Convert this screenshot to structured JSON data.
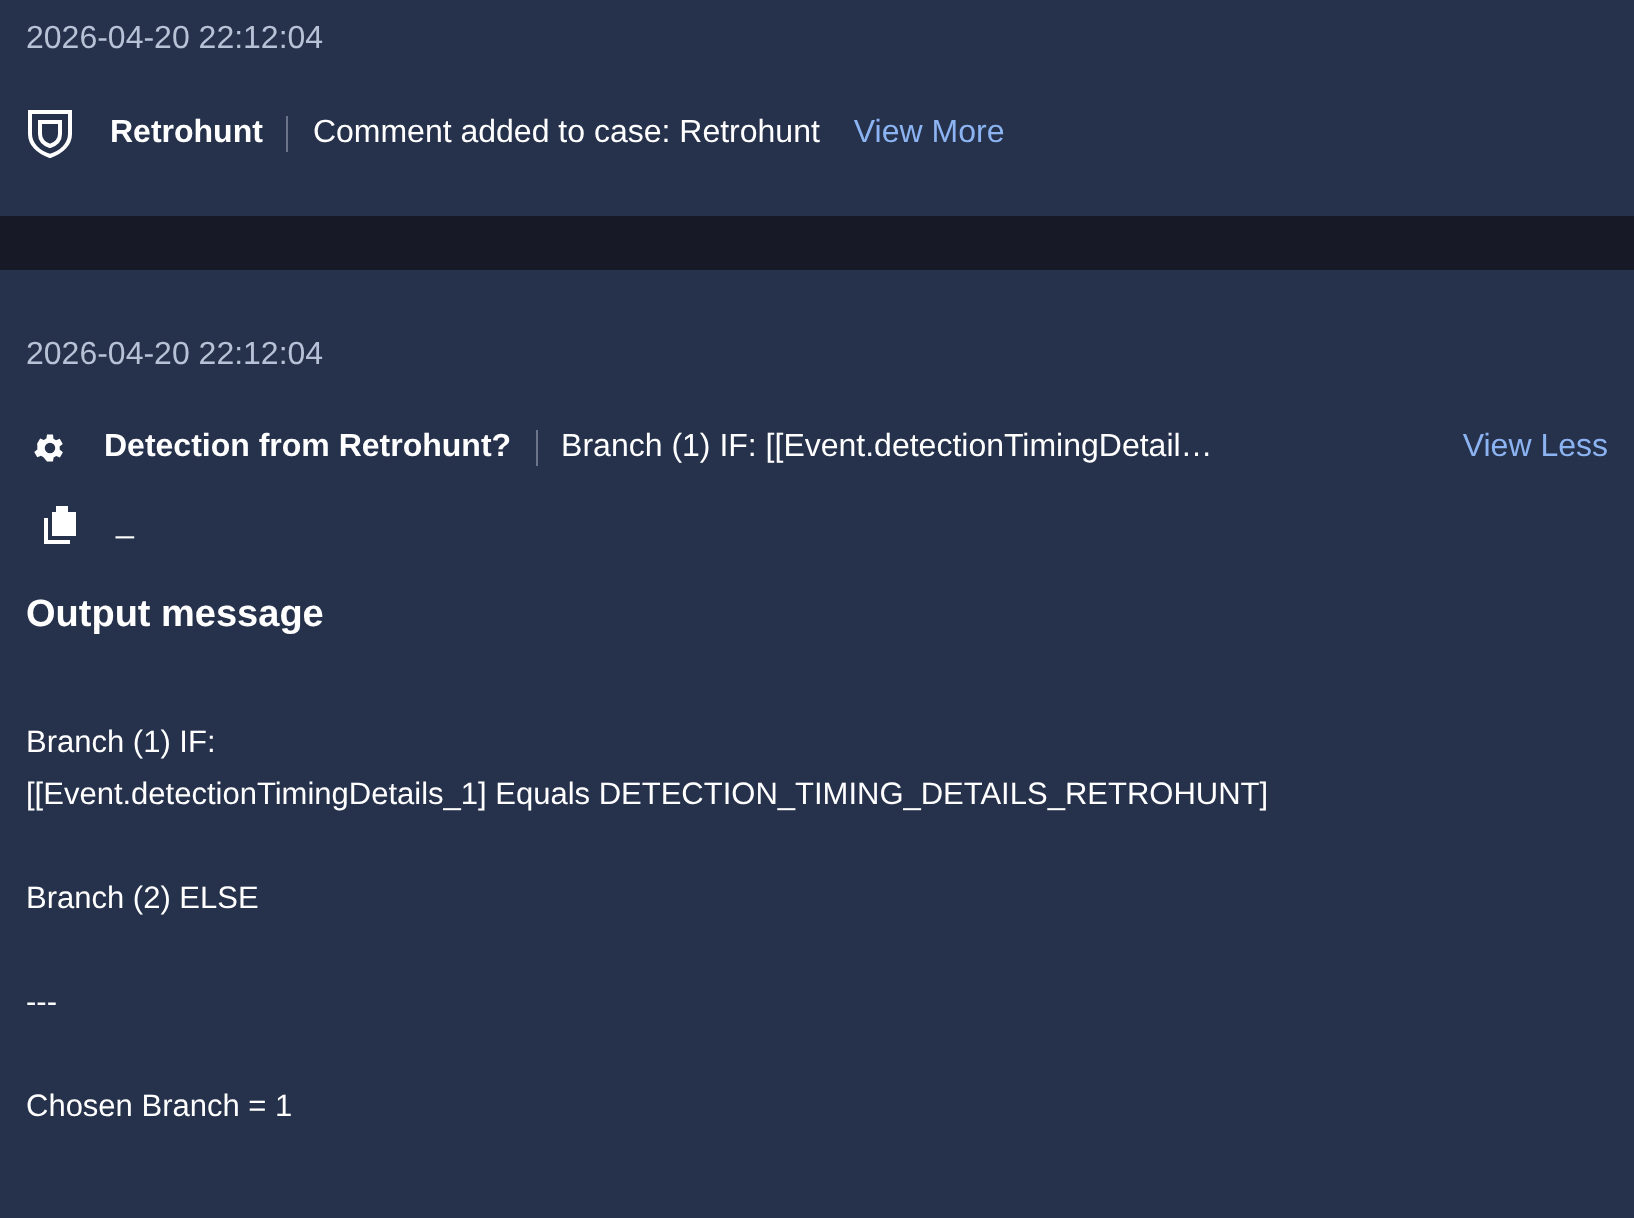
{
  "entries": [
    {
      "kind": "case_comment",
      "timestamp": "2026-04-20 22:12:04",
      "title": "Retrohunt",
      "summary": "Comment added to case: Retrohunt",
      "toggle": "View More",
      "expanded": false
    },
    {
      "kind": "condition",
      "timestamp": "2026-04-20 22:12:04",
      "title": "Detection from Retrohunt?",
      "summary": "Branch (1) IF: [[Event.detectionTimingDetail…",
      "toggle": "View Less",
      "expanded": true,
      "clipboard_value": "_",
      "output_heading": "Output message",
      "output_paragraphs": [
        [
          "Branch (1) IF:",
          "[[Event.detectionTimingDetails_1] Equals DETECTION_TIMING_DETAILS_RETROHUNT]"
        ],
        [
          "Branch (2) ELSE"
        ],
        [
          "---"
        ],
        [
          "Chosen Branch = 1"
        ]
      ]
    }
  ]
}
